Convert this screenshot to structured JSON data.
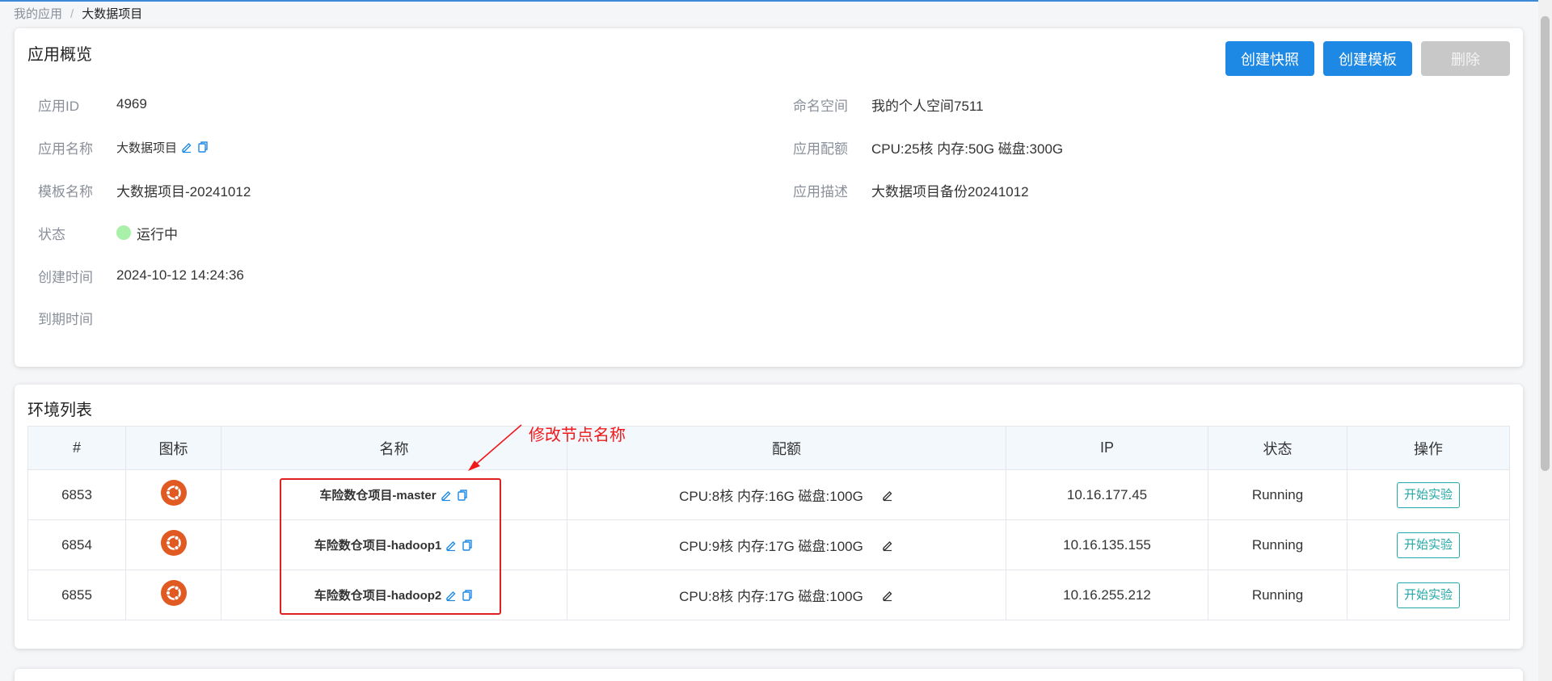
{
  "breadcrumb": {
    "parent": "我的应用",
    "separator": "/",
    "current": "大数据项目"
  },
  "overview": {
    "title": "应用概览",
    "buttons": {
      "snapshot": "创建快照",
      "template": "创建模板",
      "delete": "删除"
    },
    "fields": {
      "app_id": {
        "label": "应用ID",
        "value": "4969"
      },
      "app_name": {
        "label": "应用名称",
        "value": "大数据项目"
      },
      "template_name": {
        "label": "模板名称",
        "value": "大数据项目-20241012"
      },
      "status": {
        "label": "状态",
        "value": "运行中"
      },
      "created": {
        "label": "创建时间",
        "value": "2024-10-12 14:24:36"
      },
      "expire": {
        "label": "到期时间",
        "value": ""
      },
      "namespace": {
        "label": "命名空间",
        "value": "我的个人空间7511"
      },
      "quota": {
        "label": "应用配额",
        "value": "CPU:25核 内存:50G 磁盘:300G"
      },
      "description": {
        "label": "应用描述",
        "value": "大数据项目备份20241012"
      }
    },
    "status_color": "#a9f0a9"
  },
  "env": {
    "title": "环境列表",
    "columns": [
      "#",
      "图标",
      "名称",
      "配额",
      "IP",
      "状态",
      "操作"
    ],
    "rows": [
      {
        "id": "6853",
        "name": "车险数仓项目-master",
        "quota": "CPU:8核 内存:16G 磁盘:100G",
        "ip": "10.16.177.45",
        "status": "Running",
        "action": "开始实验"
      },
      {
        "id": "6854",
        "name": "车险数仓项目-hadoop1",
        "quota": "CPU:9核 内存:17G 磁盘:100G",
        "ip": "10.16.135.155",
        "status": "Running",
        "action": "开始实验"
      },
      {
        "id": "6855",
        "name": "车险数仓项目-hadoop2",
        "quota": "CPU:8核 内存:17G 磁盘:100G",
        "ip": "10.16.255.212",
        "status": "Running",
        "action": "开始实验"
      }
    ],
    "icon": "ubuntu-icon"
  },
  "annotation": {
    "text": "修改节点名称",
    "color": "#f01818"
  },
  "colors": {
    "primary": "#1e88e5",
    "accent": "#23a7a7",
    "ubuntu": "#e05a22"
  }
}
